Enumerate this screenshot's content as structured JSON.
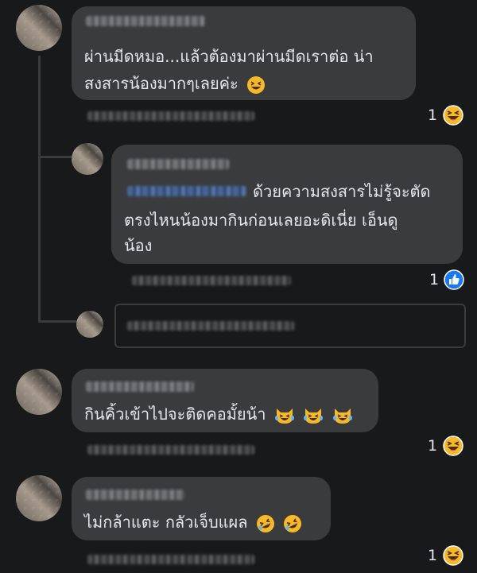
{
  "comments": [
    {
      "text_lines": [
        "ผ่านมีดหมอ...แล้วต้องมาผ่านมีดเราต่อ น่า",
        "สงสารน้องมากๆเลยค่ะ"
      ],
      "emoji": [
        "grinning-squint-face"
      ],
      "reaction": {
        "count": "1",
        "icon": "laughing-emoji-icon"
      }
    },
    {
      "text_lines": [
        "ด้วยความสงสารไม่รู้จะตัด",
        "ตรงไหนน้องมากินก่อนเลยอะดิเนี่ย เอ็นดู",
        "น้อง"
      ],
      "reaction": {
        "count": "1",
        "icon": "like-icon"
      }
    },
    {
      "text_lines": [
        "กินคิ้วเข้าไปจะติดคอมั้ยน้า"
      ],
      "emoji": [
        "cat-tears-of-joy",
        "cat-tears-of-joy",
        "cat-tears-of-joy"
      ],
      "reaction": {
        "count": "1",
        "icon": "laughing-emoji-icon"
      }
    },
    {
      "text_lines": [
        "ไม่กล้าแตะ กลัวเจ็บแผล"
      ],
      "emoji": [
        "rolling-on-floor-laughing",
        "rolling-on-floor-laughing"
      ],
      "reaction": {
        "count": "1",
        "icon": "laughing-emoji-icon"
      }
    }
  ],
  "colors": {
    "background": "#18191a",
    "bubble": "#3a3b3c",
    "text": "#e4e6eb",
    "like_blue": "#1877f2",
    "reaction_yellow": "#f7b928"
  }
}
